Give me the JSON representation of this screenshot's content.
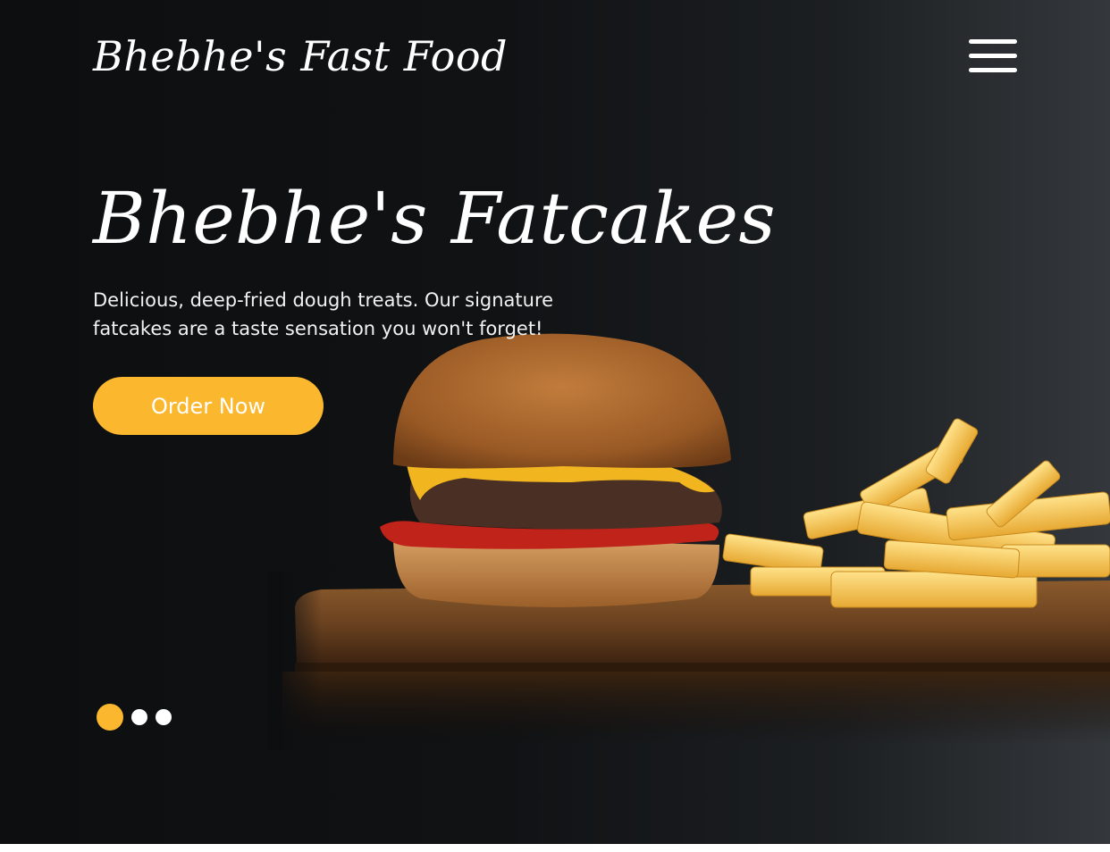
{
  "header": {
    "logo_text": "Bhebhe's Fast Food",
    "menu_icon": "hamburger-menu-icon"
  },
  "hero": {
    "title": "Bhebhe's Fatcakes",
    "description": "Delicious, deep-fried dough treats. Our signature fatcakes are a taste sensation you won't forget!",
    "cta_label": "Order Now",
    "image": "burger-and-fries-photo"
  },
  "carousel": {
    "slide_count": 3,
    "active_index": 0
  },
  "colors": {
    "accent": "#fbb82f",
    "background_dark": "#0d0e10",
    "text_light": "#ffffff"
  }
}
